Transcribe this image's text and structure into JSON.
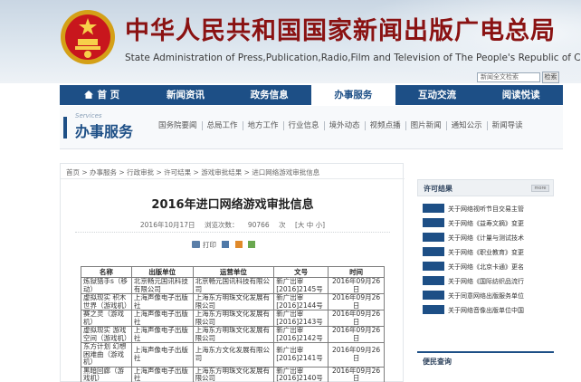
{
  "header": {
    "title_cn": "中华人民共和国国家新闻出版广电总局",
    "title_en": "State Administration of Press,Publication,Radio,Film and Television of The People's Republic of China",
    "search_placeholder": "新闻全文检索",
    "search_button": "检索"
  },
  "nav": {
    "items": [
      {
        "label": "首 页"
      },
      {
        "label": "新闻资讯"
      },
      {
        "label": "政务信息"
      },
      {
        "label": "办事服务"
      },
      {
        "label": "互动交流"
      },
      {
        "label": "阅读悦读"
      }
    ]
  },
  "subhead": {
    "title_en": "Services",
    "title_cn": "办事服务",
    "links": [
      "国务院要闻",
      "总局工作",
      "地方工作",
      "行业信息",
      "境外动态",
      "视频点播",
      "图片新闻",
      "通知公示",
      "新闻导读"
    ]
  },
  "breadcrumb": "首页 > 办事服务 > 行政审批 > 许可结果 > 游戏审批结果 > 进口网络游戏审批信息",
  "article": {
    "title": "2016年进口网络游戏审批信息",
    "date": "2016年10月17日",
    "views_label": "浏览次数：",
    "views": "90766",
    "views_unit": "次",
    "size_options": "[大 中 小]",
    "print_label": "打印"
  },
  "table": {
    "headers": [
      "名称",
      "出版单位",
      "运营单位",
      "文号",
      "时间"
    ],
    "rows": [
      [
        "炼狱猎手s（移动）",
        "北京畅元国讯科技有限公司",
        "北京畅元国讯科技有限公司",
        "新广出审[2016]2145号",
        "2016年09月26日"
      ],
      [
        "虚拟现实 积木世界（游戏机）",
        "上海声像电子出版社",
        "上海东方明珠文化发展有限公司",
        "新广出审[2016]2144号",
        "2016年09月26日"
      ],
      [
        "赛之灵（游戏机）",
        "上海声像电子出版社",
        "上海东方明珠文化发展有限公司",
        "新广出审[2016]2143号",
        "2016年09月26日"
      ],
      [
        "虚拟现实 游戏空间（游戏机）",
        "上海声像电子出版社",
        "上海东方明珠文化发展有限公司",
        "新广出审[2016]2142号",
        "2016年09月26日"
      ],
      [
        "东方计划 幻想困难曲（游戏机）",
        "上海声像电子出版社",
        "上海东方文化发展有限公司",
        "新广出审[2016]2141号",
        "2016年09月26日"
      ],
      [
        "黑暗回廊（游戏机）",
        "上海声像电子出版社",
        "上海东方明珠文化发展有限公司",
        "新广出审[2016]2140号",
        "2016年09月26日"
      ]
    ]
  },
  "sidebar": {
    "title": "许可结果",
    "more": "more",
    "items": [
      "关于网络视听节目交易主管",
      "关于网络《益寿文摘》变更",
      "关于网络《计量与测试技术",
      "关于网络《职业教育》变更",
      "关于网络《北京卡通》更名",
      "关于网络《国际纺织品流行",
      "关于同意网络出版服务单位",
      "关于网络音像出版单位中国"
    ],
    "title2": "便民查询"
  }
}
